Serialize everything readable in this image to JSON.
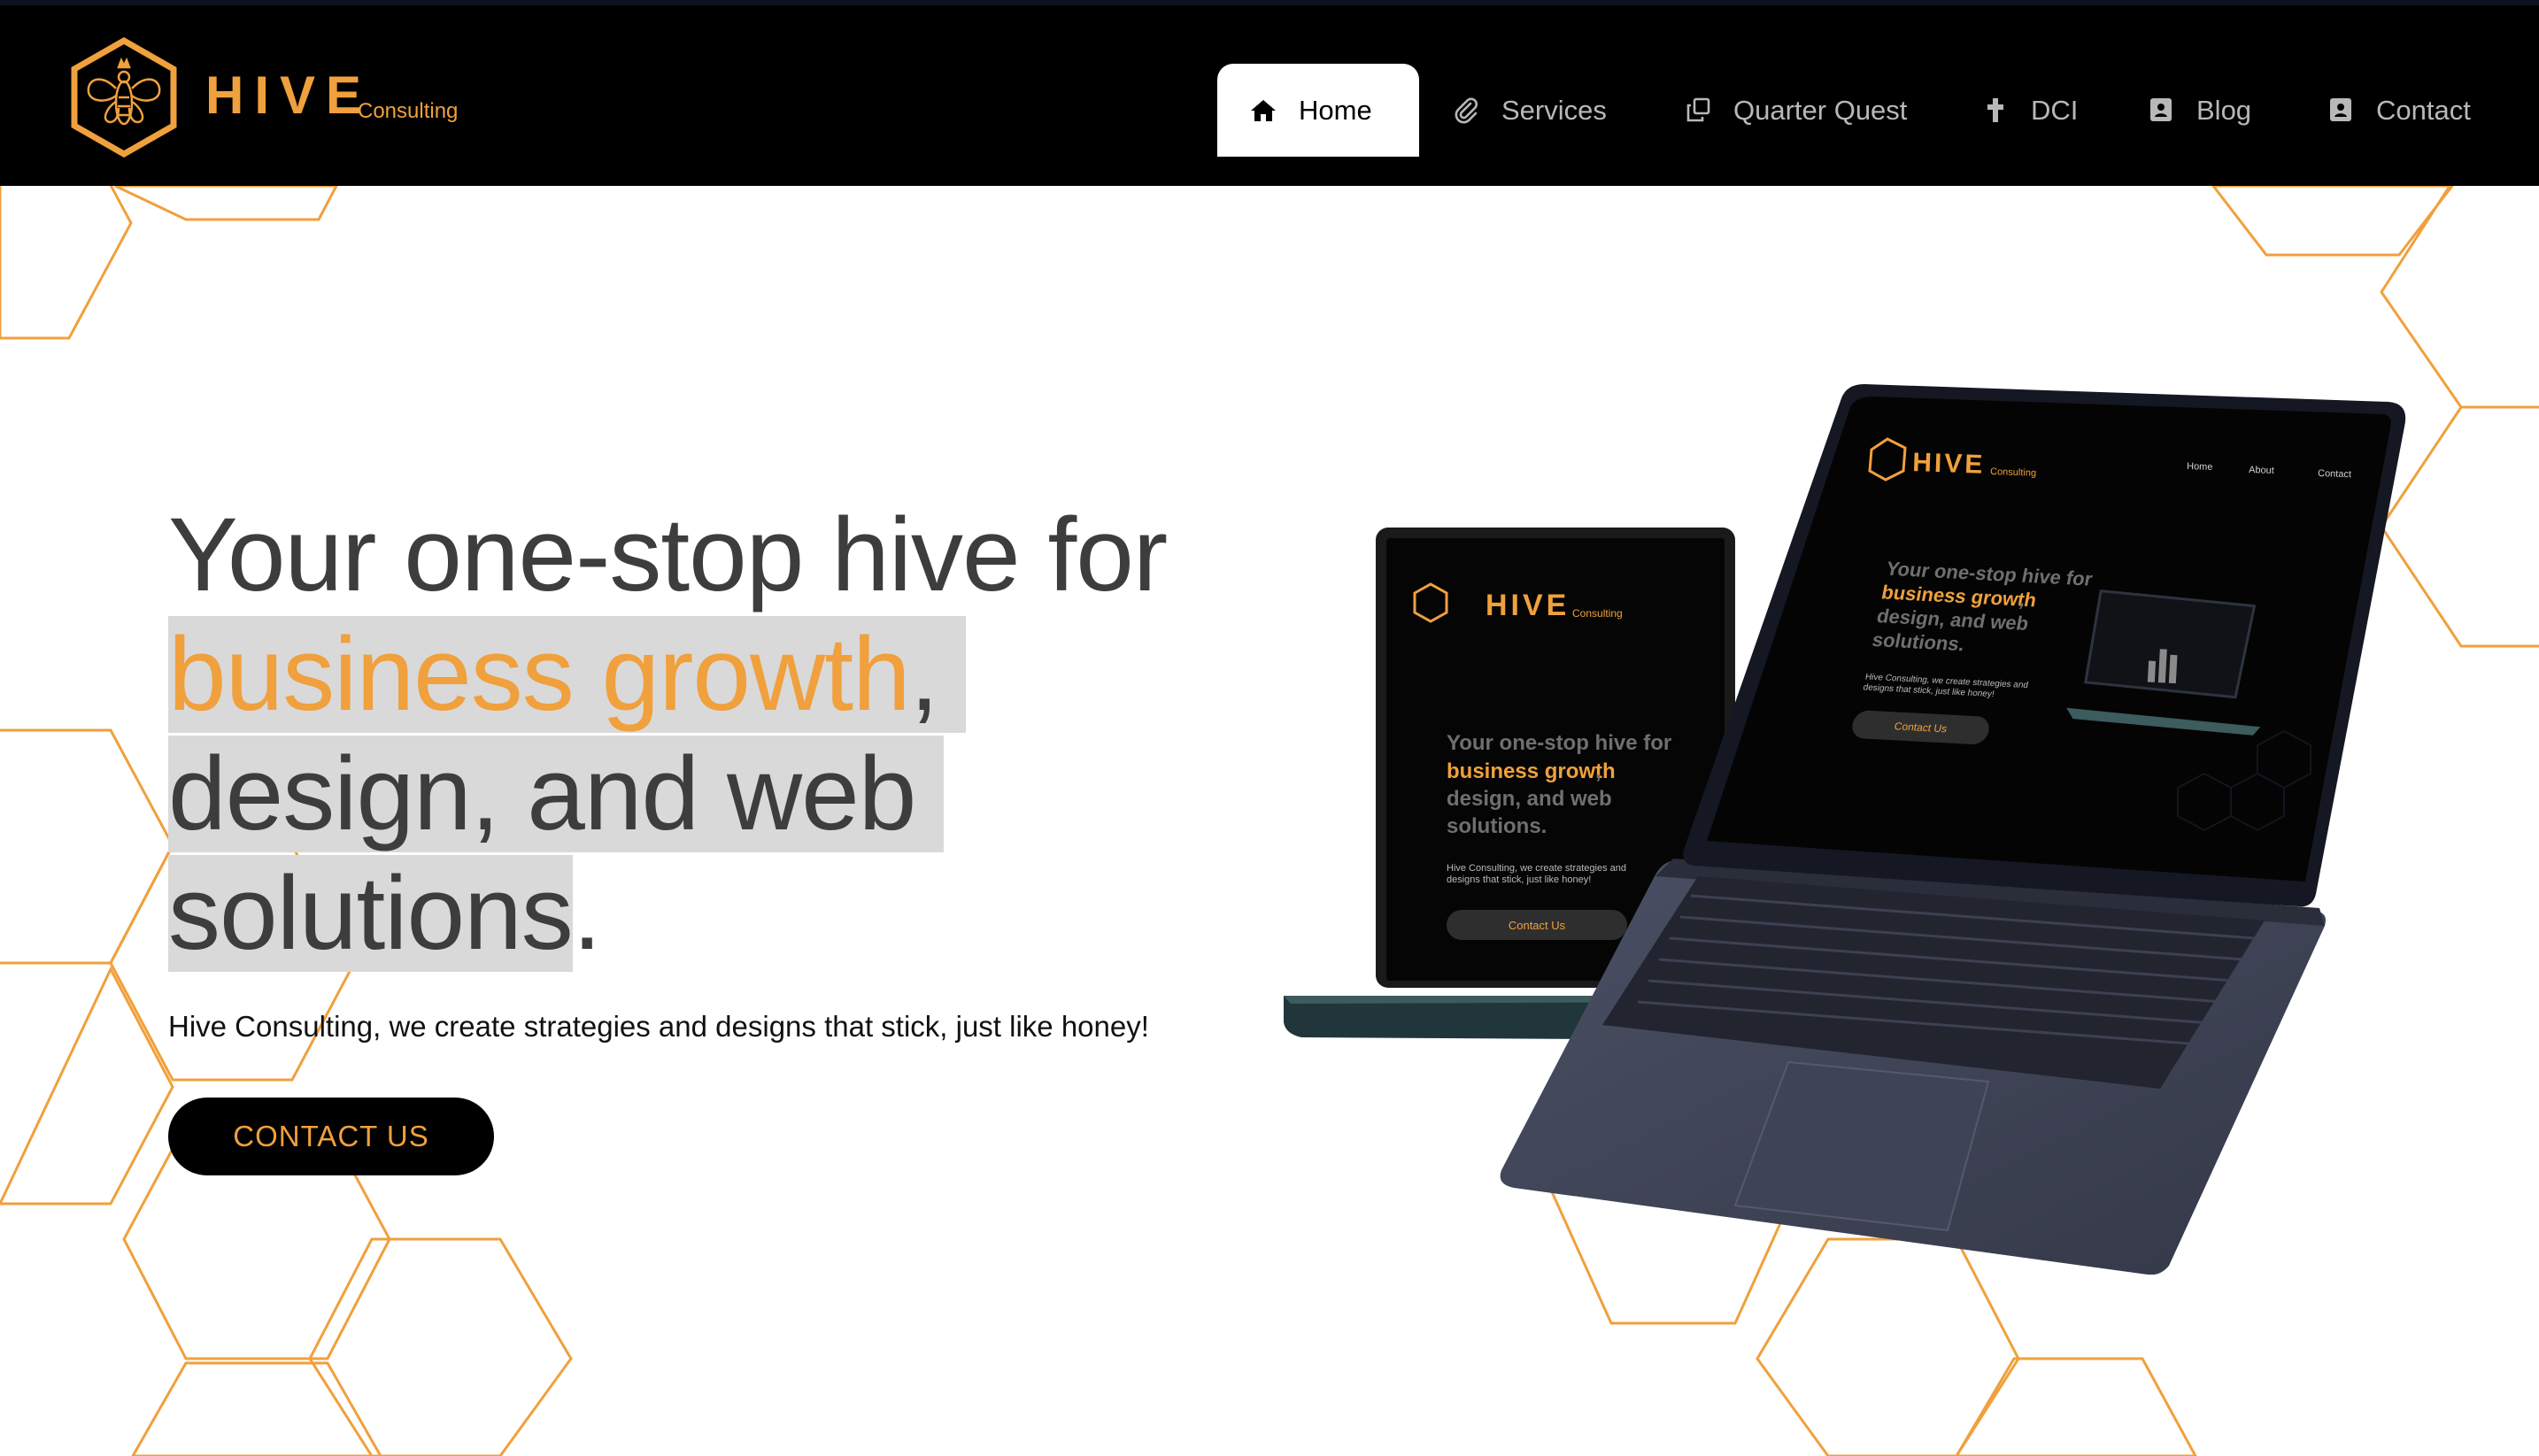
{
  "brand": {
    "name": "HIVE",
    "tagline": "Consulting"
  },
  "nav": {
    "items": [
      {
        "label": "Home",
        "icon": "home-icon",
        "active": true
      },
      {
        "label": "Services",
        "icon": "paperclip-icon"
      },
      {
        "label": "Quarter Quest",
        "icon": "copy-icon"
      },
      {
        "label": "DCI",
        "icon": "cross-icon"
      },
      {
        "label": "Blog",
        "icon": "contact-card-icon"
      },
      {
        "label": "Contact",
        "icon": "contact-card-icon"
      }
    ]
  },
  "hero": {
    "headline_1": "Your one-stop hive for",
    "headline_accent": "business growth",
    "headline_comma": ",",
    "headline_2": "design, and web",
    "headline_3": "solutions",
    "headline_period": ".",
    "subtext": "Hive Consulting, we create strategies and designs that stick, just like honey!",
    "cta_label": "CONTACT US"
  },
  "mockup": {
    "front": {
      "brand": "HIVE",
      "tagline": "Consulting",
      "nav": [
        "Home",
        "About",
        "Contact"
      ],
      "headline_1": "Your one-stop hive for",
      "headline_accent": "business growth",
      "headline_comma": ",",
      "headline_2": "design, and web",
      "headline_3": "solutions.",
      "body_1": "Hive Consulting, we create strategies and",
      "body_2": "designs that stick, just like honey!",
      "cta": "Contact Us"
    },
    "back": {
      "brand": "HIVE",
      "tagline": "Consulting",
      "headline_1": "Your one-stop hive for",
      "headline_accent": "business growth",
      "headline_comma": ",",
      "headline_2": "design, and web",
      "headline_3": "solutions.",
      "body_1": "Hive Consulting, we create strategies and",
      "body_2": "designs that stick, just like honey!",
      "cta": "Contact Us"
    }
  },
  "colors": {
    "accent": "#f0a03c",
    "header_bg": "#000000",
    "text_dark": "#3d3d3d"
  }
}
